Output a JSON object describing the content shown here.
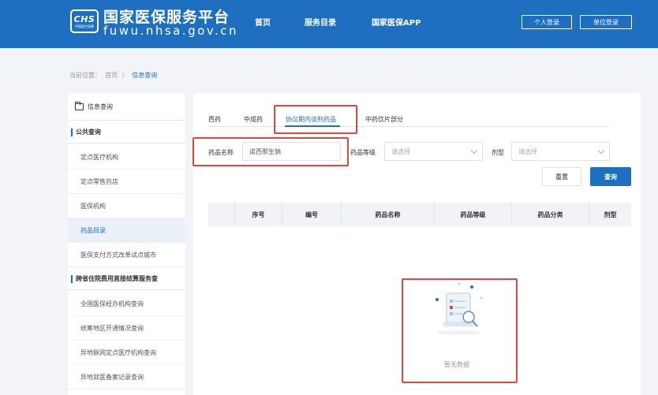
{
  "header": {
    "logo_text": "CHS",
    "logo_sub": "中国医疗保障",
    "site_title": "国家医保服务平台",
    "site_url": "fuwu.nhsa.gov.cn",
    "nav": [
      "首页",
      "服务目录",
      "国家医保APP"
    ],
    "personal_login": "个人登录",
    "unit_login": "单位登录"
  },
  "breadcrumb": {
    "prefix": "当前位置：",
    "home": "首页",
    "separator": "〉",
    "current": "信息查询"
  },
  "sidebar": {
    "title": "信息查询",
    "group1": "公共查询",
    "group1_items": [
      "定点医疗机构",
      "定点零售药店",
      "医保机构",
      "药品目录",
      "医保支付方式改革试点城市"
    ],
    "active_item": "药品目录",
    "group2": "跨省住院费用直接结算服务查",
    "group2_items": [
      "全国医保经办机构查询",
      "统筹地区开通情况查询",
      "异地联网定点医疗机构查询",
      "异地就医备案记录查询"
    ]
  },
  "main": {
    "tabs": [
      "西药",
      "中成药",
      "协议期内谈判药品",
      "中药饮片部分"
    ],
    "active_tab": "协议期内谈判药品",
    "drug_name_label": "药品名称",
    "drug_name_value": "诺西那生钠",
    "grade_label": "药品等级",
    "grade_placeholder": "请选择",
    "form_label": "剂型",
    "form_placeholder": "请选择",
    "reset_label": "重置",
    "query_label": "查询",
    "columns": [
      "序号",
      "编号",
      "药品名称",
      "药品等级",
      "药品分类",
      "剂型"
    ],
    "empty_text": "暂无数据"
  },
  "colors": {
    "brand_blue": "#1e6fc0",
    "highlight_red": "#e0483b"
  }
}
